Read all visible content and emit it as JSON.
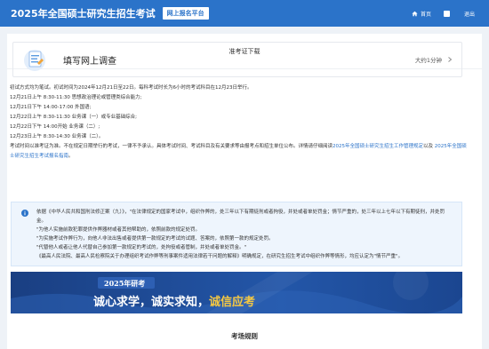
{
  "header": {
    "title": "2025年全国硕士研究生招生考试",
    "badge": "网上报名平台",
    "nav_home": "首页",
    "logout": "退出"
  },
  "card": {
    "title": "准考证下载"
  },
  "survey": {
    "title": "填写网上调查",
    "time": "大约1分钟"
  },
  "exam": {
    "intro": "初试方式均为笔试。初试时间为2024年12月21日至22日。每科考试时长为6小时的考试科目在12月23日举行。",
    "schedule": [
      "12月21日上午 8:30-11:30 思想政治理论或管理类综合能力;",
      "12月21日下午 14:00-17:00 外国语;",
      "12月22日上午 8:30-11:30 业务课（一）或专业基础综合;",
      "12月22日下午 14:00开始 业务课（二）;",
      "12月23日上午 8:30-14:30 业务课（二）。"
    ],
    "notice_before": "考试时间以准考证为准。不在规定日期举行的考试，一律不予承认。具体考试时间、考试科目及有关要求等由报考点和招生单位公布。详情请仔细阅读",
    "notice_link1": "2025年全国硕士研究生招生工作管理规定",
    "notice_mid": "以及",
    "notice_link2": "2025年全国硕士研究生招生考试报名指南",
    "notice_end": "。"
  },
  "legal": {
    "lines": [
      "依据《中华人民共和国刑法修正案（九）》，\"在法律规定的国家考试中，组织作弊的，处三年以下有期徒刑或者拘役，并处或者单处罚金；情节严重的，处三年以上七年以下有期徒刑，并处罚金。",
      "\"为他人实施前款犯罪提供作弊器材或者其他帮助的，依照前款的规定处罚。",
      "\"为实施考试作弊行为，向他人非法出售或者提供第一款规定的考试的试题、答案的，依照第一款的规定处罚。",
      "\"代替他人或者让他人代替自己参加第一款规定的考试的，处拘役或者管制，并处或者单处罚金。\"",
      "《最高人民法院、最高人民检察院关于办理组织考试作弊等刑事案件适用法律若干问题的解释》明确规定，在研究生招生考试中组织作弊等情形，均应认定为\"情节严重\"。"
    ]
  },
  "banner": {
    "year": "2025年研考",
    "slogan_main": "诚心求学，诚实求知，",
    "slogan_highlight": "诚信应考"
  },
  "rules": {
    "title": "考场规则"
  },
  "colors": {
    "primary": "#2b73c9",
    "banner_bg": "#1f4a93",
    "highlight": "#f5c842",
    "notice_bg": "#eef5fd"
  },
  "icons": {
    "home": "home-icon",
    "user": "user-square-icon",
    "survey": "survey-document-icon",
    "chevron": "chevron-right-icon",
    "info": "info-icon"
  }
}
